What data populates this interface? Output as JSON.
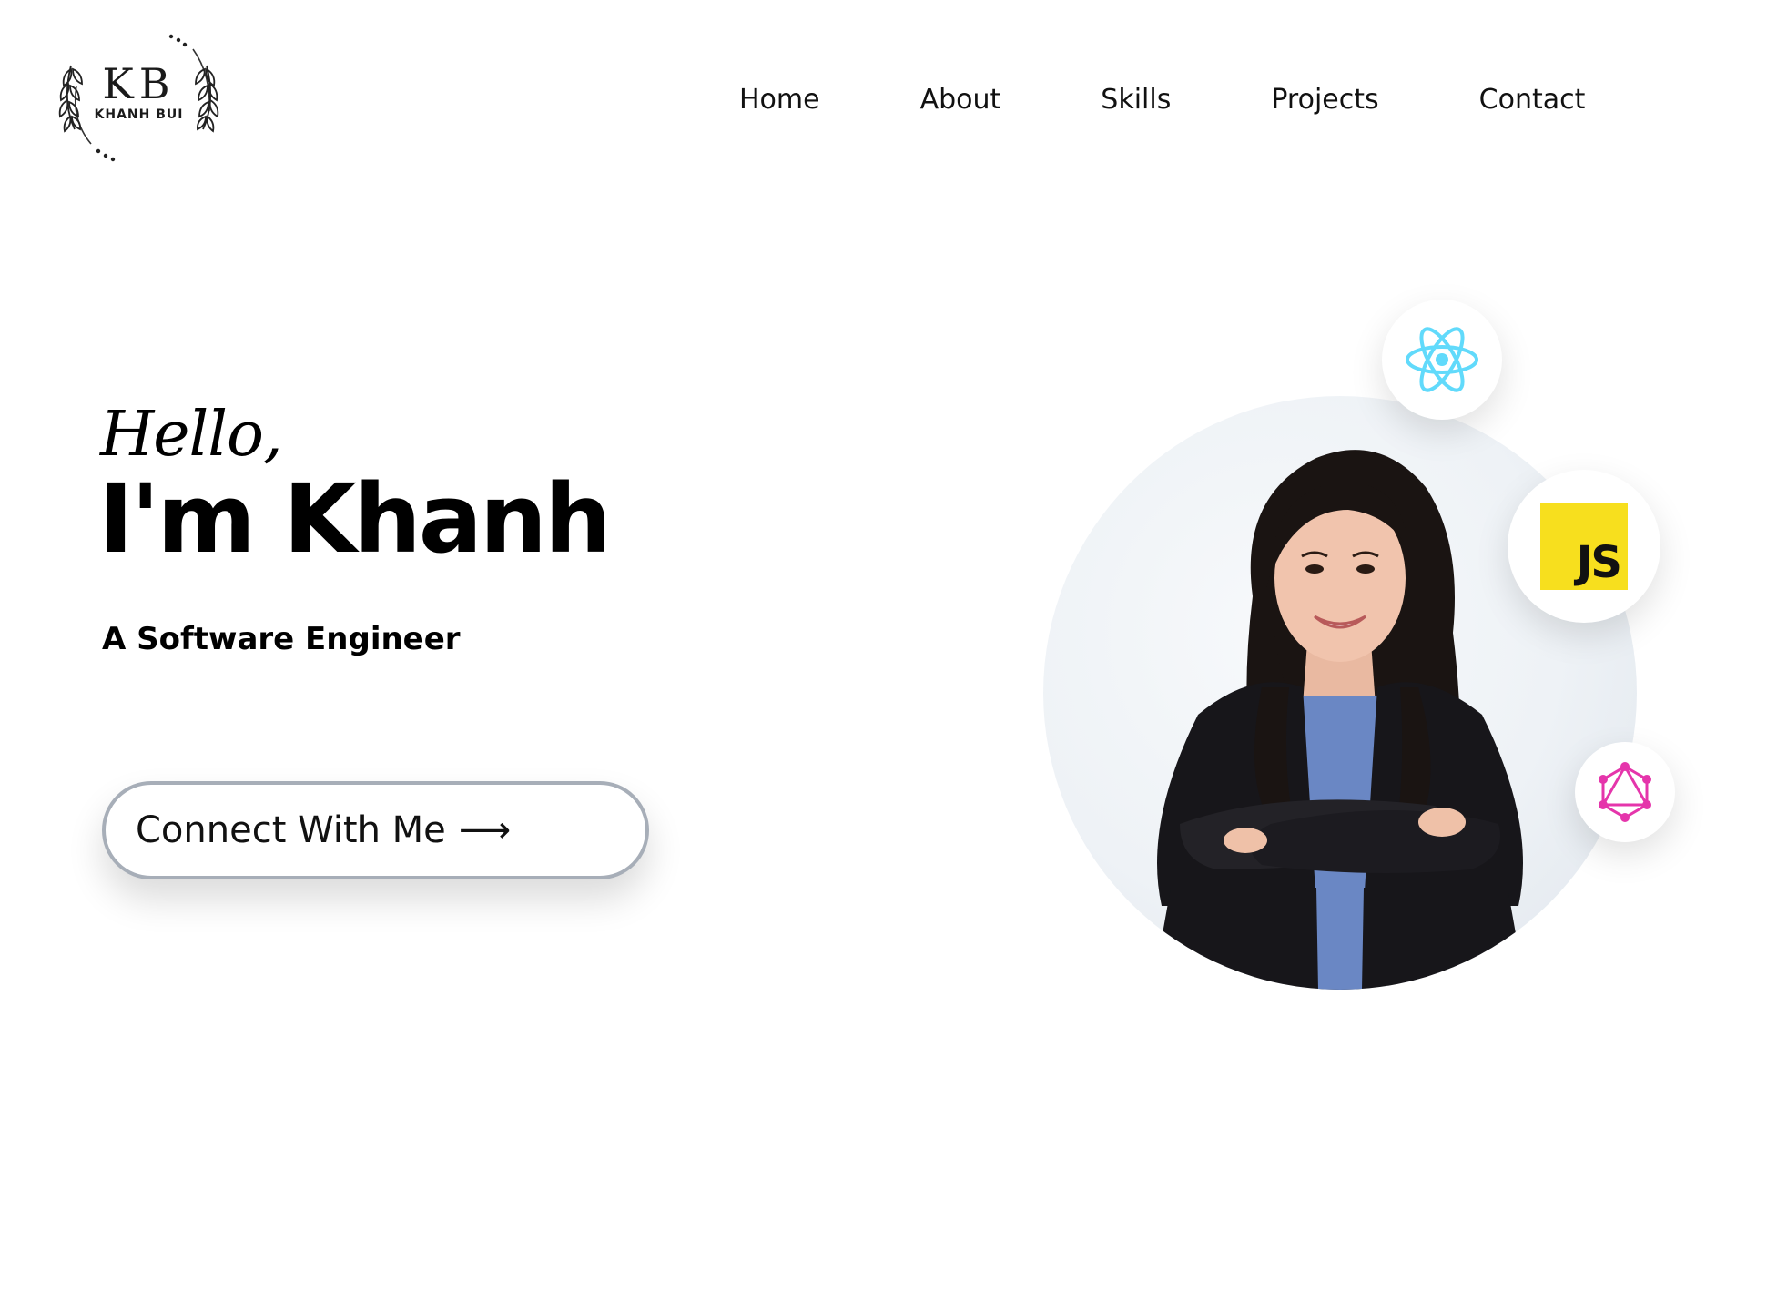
{
  "header": {
    "logo": {
      "initials": "KB",
      "name": "KHANH BUI"
    },
    "nav": [
      {
        "label": "Home"
      },
      {
        "label": "About"
      },
      {
        "label": "Skills"
      },
      {
        "label": "Projects"
      },
      {
        "label": "Contact"
      }
    ]
  },
  "hero": {
    "greeting": "Hello,",
    "headline": "I'm Khanh",
    "subtitle": "A Software Engineer",
    "cta_label": "Connect With Me",
    "cta_arrow": "⟶"
  },
  "skills": {
    "icons": [
      "react-icon",
      "javascript-icon",
      "graphql-icon"
    ],
    "js_badge_text": "JS"
  },
  "colors": {
    "react": "#61dafb",
    "javascript_bg": "#f7df1e",
    "graphql": "#e535ab",
    "button_border": "#a7aeb8"
  }
}
